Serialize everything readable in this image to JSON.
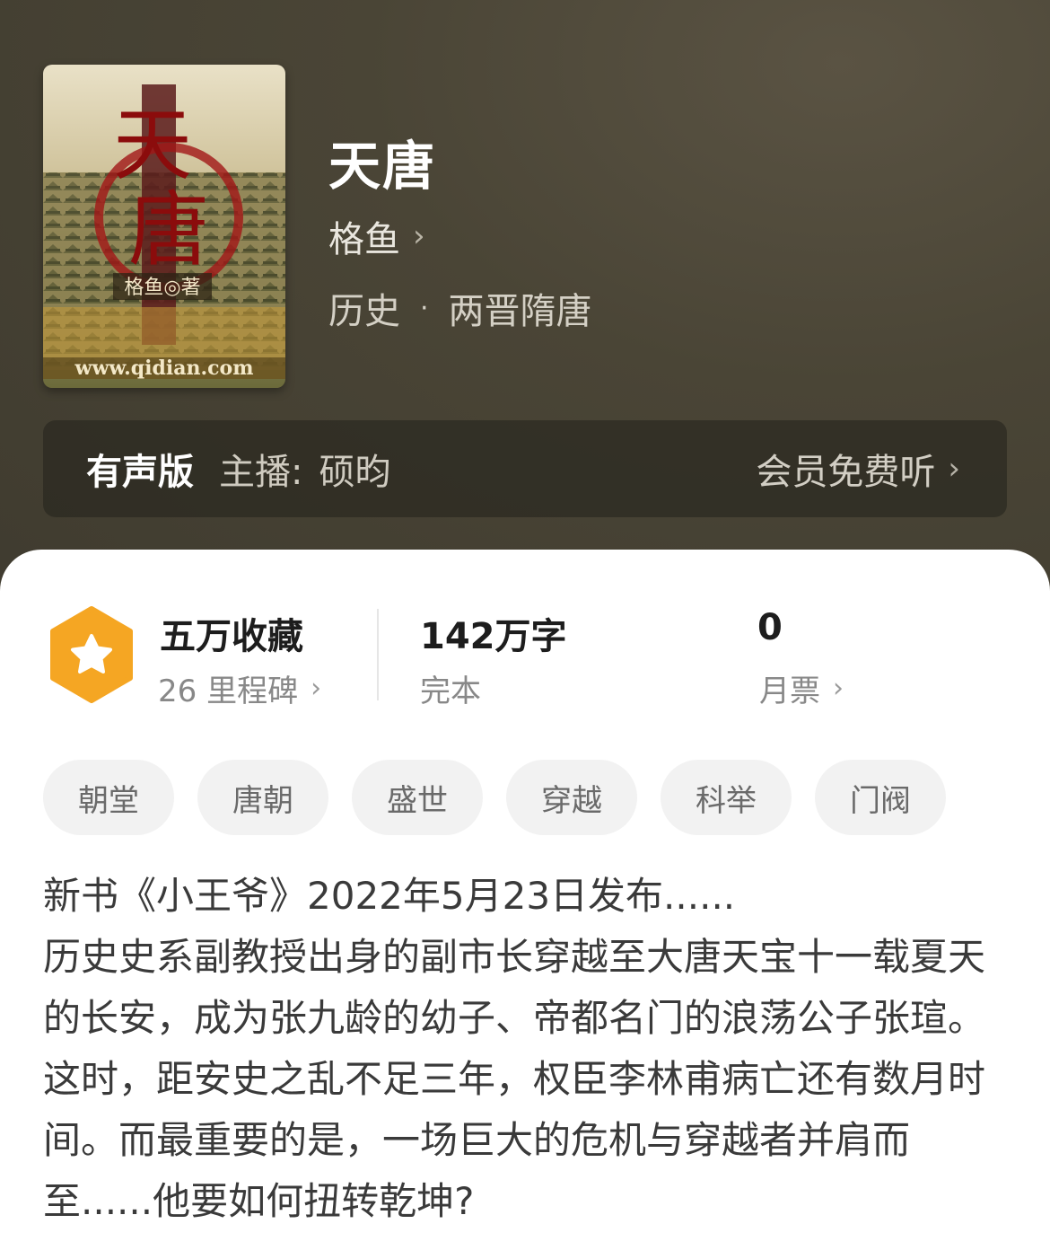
{
  "book": {
    "title": "天唐",
    "author": "格鱼",
    "category": "历史",
    "subcategory": "两晋隋唐",
    "cover": {
      "title_chars": [
        "天",
        "唐"
      ],
      "author_text": "格鱼◎著",
      "site_text": "www.qidian.com"
    }
  },
  "audio": {
    "label": "有声版",
    "host_label": "主播:",
    "host_name": "硕昀",
    "cta": "会员免费听"
  },
  "stats": {
    "collection": {
      "main": "五万收藏",
      "sub": "26 里程碑"
    },
    "words": {
      "main": "142万字",
      "sub": "完本"
    },
    "tickets": {
      "main": "0",
      "sub": "月票"
    }
  },
  "tags": [
    "朝堂",
    "唐朝",
    "盛世",
    "穿越",
    "科举",
    "门阀"
  ],
  "description": {
    "line1": "新书《小王爷》2022年5月23日发布......",
    "line2": "历史史系副教授出身的副市长穿越至大唐天宝十一载夏天的长安，成为张九龄的幼子、帝都名门的浪荡公子张瑄。这时，距安史之乱不足三年，权臣李林甫病亡还有数月时间。而最重要的是，一场巨大的危机与穿越者并肩而至......他要如何扭转乾坤?"
  },
  "colors": {
    "header_bg": "#4a4536",
    "badge": "#f5a623",
    "tag_bg": "#f2f2f2"
  }
}
